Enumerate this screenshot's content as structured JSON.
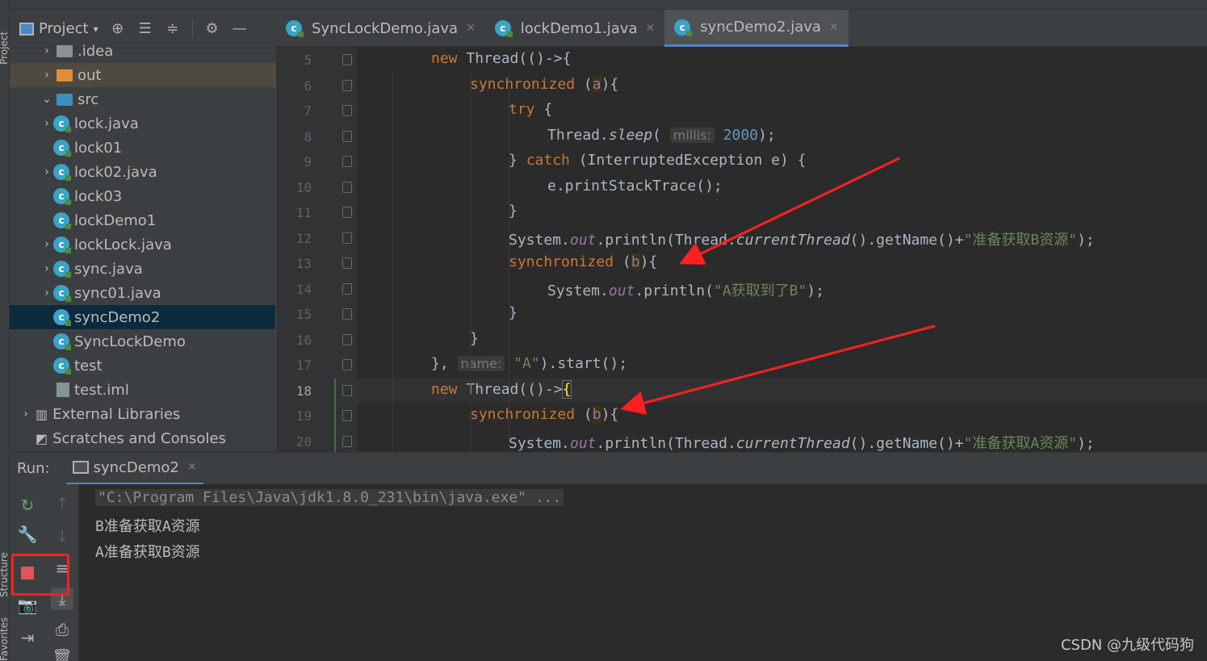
{
  "side_strip": {
    "project_label": "Project",
    "structure_label": "Structure",
    "favorites_label": "Favorites"
  },
  "project": {
    "title": "Project",
    "items": [
      {
        "label": ".idea",
        "kind": "folder-grey",
        "depth": 1,
        "expandable": true,
        "state": "collapsed"
      },
      {
        "label": "out",
        "kind": "folder-orange",
        "depth": 1,
        "expandable": true,
        "state": "collapsed",
        "highlight": "out"
      },
      {
        "label": "src",
        "kind": "folder-blue",
        "depth": 1,
        "expandable": true,
        "state": "expanded"
      },
      {
        "label": "lock.java",
        "kind": "class",
        "depth": 2,
        "expandable": true,
        "state": "collapsed"
      },
      {
        "label": "lock01",
        "kind": "class",
        "depth": 2,
        "expandable": false
      },
      {
        "label": "lock02.java",
        "kind": "class",
        "depth": 2,
        "expandable": true,
        "state": "collapsed"
      },
      {
        "label": "lock03",
        "kind": "class",
        "depth": 2,
        "expandable": false
      },
      {
        "label": "lockDemo1",
        "kind": "class",
        "depth": 2,
        "expandable": false
      },
      {
        "label": "lockLock.java",
        "kind": "class",
        "depth": 2,
        "expandable": true,
        "state": "collapsed"
      },
      {
        "label": "sync.java",
        "kind": "class",
        "depth": 2,
        "expandable": true,
        "state": "collapsed"
      },
      {
        "label": "sync01.java",
        "kind": "class",
        "depth": 2,
        "expandable": true,
        "state": "collapsed"
      },
      {
        "label": "syncDemo2",
        "kind": "class",
        "depth": 2,
        "expandable": false,
        "selected": true
      },
      {
        "label": "SyncLockDemo",
        "kind": "class",
        "depth": 2,
        "expandable": false
      },
      {
        "label": "test",
        "kind": "class",
        "depth": 2,
        "expandable": false
      },
      {
        "label": "test.iml",
        "kind": "iml",
        "depth": 1,
        "expandable": false
      },
      {
        "label": "External Libraries",
        "kind": "libraries",
        "depth": 0,
        "expandable": true,
        "state": "collapsed"
      },
      {
        "label": "Scratches and Consoles",
        "kind": "scratches",
        "depth": 0,
        "expandable": false
      }
    ]
  },
  "tabs": [
    {
      "label": "SyncLockDemo.java",
      "active": false
    },
    {
      "label": "lockDemo1.java",
      "active": false
    },
    {
      "label": "syncDemo2.java",
      "active": true
    }
  ],
  "editor": {
    "current_line": 18,
    "lines": [
      {
        "n": "5",
        "code": "new Thread(()->{"
      },
      {
        "n": "6",
        "code": "synchronized (a){"
      },
      {
        "n": "7",
        "code": "try {"
      },
      {
        "n": "8",
        "code": "Thread.sleep( millis: 2000);"
      },
      {
        "n": "9",
        "code": "} catch (InterruptedException e) {"
      },
      {
        "n": "10",
        "code": "e.printStackTrace();"
      },
      {
        "n": "11",
        "code": "}"
      },
      {
        "n": "12",
        "code": "System.out.println(Thread.currentThread().getName()+\"准备获取B资源\");"
      },
      {
        "n": "13",
        "code": "synchronized (b){"
      },
      {
        "n": "14",
        "code": "System.out.println(\"A获取到了B\");"
      },
      {
        "n": "15",
        "code": "}"
      },
      {
        "n": "16",
        "code": "}"
      },
      {
        "n": "17",
        "code": "}, name: \"A\").start();"
      },
      {
        "n": "18",
        "code": "new Thread(()->{"
      },
      {
        "n": "19",
        "code": "synchronized (b){"
      },
      {
        "n": "20",
        "code": "System.out.println(Thread.currentThread().getName()+\"准备获取A资源\");"
      }
    ],
    "tokens": {
      "new": "new",
      "thread": "Thread",
      "lambda_open": "(()->{",
      "lambda_open_prefix": "(()->",
      "brace_open": "{",
      "synchronized": "synchronized",
      "var_a": "a",
      "var_b": "b",
      "paren_open": "(",
      "close_brace_paren": "){",
      "try": "try",
      "space_brace": " {",
      "sleep_prefix": "Thread.",
      "sleep": "sleep",
      "paren": "(",
      "hint_millis": "millis:",
      "num_2000": "2000",
      "end_paren_semi": ");",
      "close_brace": "}",
      "catch": "catch",
      "catch_rest": " (InterruptedException e) {",
      "print_stack": "e.printStackTrace();",
      "system": "System.",
      "out": "out",
      "println_open": ".println(",
      "thread_prefix": "Thread.",
      "current_thread": "currentThread",
      "get_name": "().getName()+",
      "str_prepare_b": "\"准备获取B资源\"",
      "str_prepare_a": "\"准备获取A资源\"",
      "str_a_got_b": "\"A获取到了B\"",
      "close_comma": "},",
      "hint_name": "name:",
      "str_a": "\"A\"",
      "start": ").start();",
      "semi": ";"
    }
  },
  "run": {
    "label": "Run:",
    "tab": "syncDemo2",
    "output": [
      "\"C:\\Program Files\\Java\\jdk1.8.0_231\\bin\\java.exe\" ...",
      "B准备获取A资源",
      "A准备获取B资源"
    ]
  },
  "watermark": "CSDN @九级代码狗",
  "colors": {
    "annotation_red": "#ff2020",
    "accent_blue": "#4a88c7",
    "keyword": "#cc7832",
    "string": "#6a8759",
    "number": "#6897bb",
    "field": "#9876aa"
  }
}
